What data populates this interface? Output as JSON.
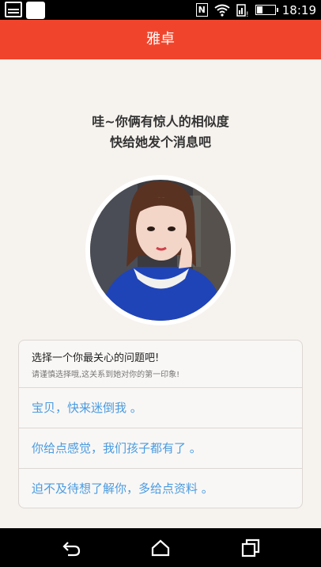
{
  "status_bar": {
    "time": "18:19",
    "icons": [
      "nfc-icon",
      "wifi-icon",
      "signal-icon",
      "battery-icon"
    ]
  },
  "app": {
    "title": "雅卓"
  },
  "match": {
    "line1": "哇~你俩有惊人的相似度",
    "line2": "快给她发个消息吧"
  },
  "question": {
    "title": "选择一个你最关心的问题吧!",
    "subtitle": "请谨慎选择哦,这关系到她对你的第一印象!",
    "options": [
      "宝贝，快来迷倒我 。",
      "你给点感觉，我们孩子都有了 。",
      "迫不及待想了解你，多给点资料 。"
    ]
  },
  "colors": {
    "accent": "#f0452c",
    "option_text": "#4a9be0"
  },
  "nav_bar": {
    "buttons": [
      "back-icon",
      "home-icon",
      "recents-icon"
    ]
  }
}
